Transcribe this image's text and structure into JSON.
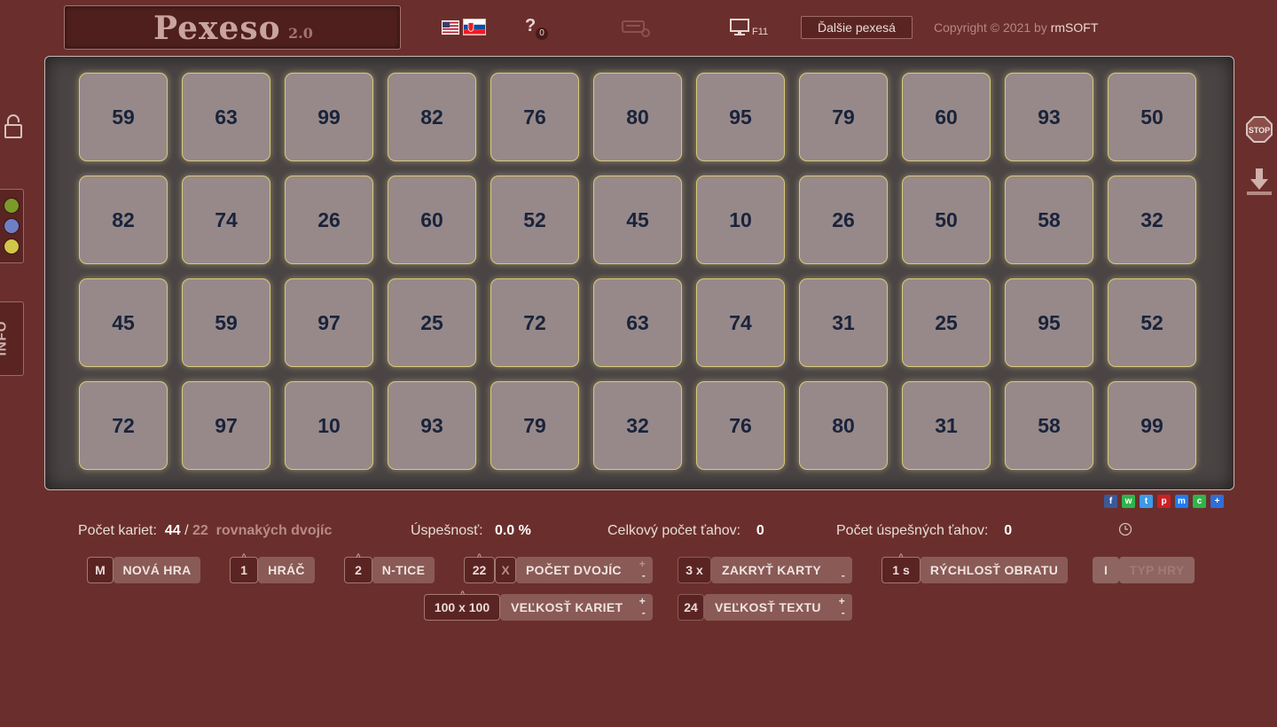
{
  "header": {
    "title": "Pexeso",
    "version": "2.0",
    "help_count": "0",
    "fullscreen_key": "F11",
    "more_games_label": "Ďalšie pexesá",
    "copyright_text": "Copyright © 2021 by ",
    "copyright_brand": "rmSOFT"
  },
  "colors": {
    "background": "#6a2f2c",
    "card": "#978989",
    "card_border": "#d8c97a",
    "number": "#19233b",
    "board": "#4a4444"
  },
  "side": {
    "info_label": "INFO",
    "dots": [
      "#7c9a2a",
      "#6f7fc4",
      "#cfc64a"
    ]
  },
  "board": {
    "rows": [
      [
        "59",
        "63",
        "99",
        "82",
        "76",
        "80",
        "95",
        "79",
        "60",
        "93",
        "50"
      ],
      [
        "82",
        "74",
        "26",
        "60",
        "52",
        "45",
        "10",
        "26",
        "50",
        "58",
        "32"
      ],
      [
        "45",
        "59",
        "97",
        "25",
        "72",
        "63",
        "74",
        "31",
        "25",
        "95",
        "52"
      ],
      [
        "72",
        "97",
        "10",
        "93",
        "79",
        "32",
        "76",
        "80",
        "31",
        "58",
        "99"
      ]
    ]
  },
  "share_icons": [
    {
      "name": "facebook-icon",
      "glyph": "f",
      "color": "#3b5998"
    },
    {
      "name": "whatsapp-icon",
      "glyph": "w",
      "color": "#2fb44b"
    },
    {
      "name": "twitter-icon",
      "glyph": "t",
      "color": "#3d9ae8"
    },
    {
      "name": "pinterest-icon",
      "glyph": "p",
      "color": "#cb2027"
    },
    {
      "name": "messenger-icon",
      "glyph": "m",
      "color": "#1f7bf2"
    },
    {
      "name": "wechat-icon",
      "glyph": "c",
      "color": "#2fb44b"
    },
    {
      "name": "addthis-icon",
      "glyph": "+",
      "color": "#2f6ed8"
    }
  ],
  "stats": {
    "cards_label": "Počet kariet:",
    "cards_value": "44",
    "slash": "/",
    "pairs_value": "22",
    "pairs_label": "rovnakých dvojíc",
    "success_label": "Úspešnosť:",
    "success_value": "0.0 %",
    "total_moves_label": "Celkový počet ťahov:",
    "total_moves_value": "0",
    "successful_moves_label": "Počet úspešných ťahov:",
    "successful_moves_value": "0"
  },
  "controls": {
    "new_game": {
      "key": "M",
      "label": "NOVÁ HRA"
    },
    "player": {
      "key": "1",
      "label": "HRÁČ"
    },
    "ntice": {
      "key": "2",
      "label": "N-TICE"
    },
    "pairs": {
      "key": "22",
      "x": "X",
      "label": "POČET DVOJÍC"
    },
    "cover": {
      "key": "3 x",
      "label": "ZAKRYŤ KARTY"
    },
    "speed": {
      "key": "1 s",
      "label": "RÝCHLOSŤ OBRATU"
    },
    "game_type": {
      "key": "I",
      "label": "TYP HRY"
    },
    "card_size": {
      "key": "100 x 100",
      "label": "VEĽKOSŤ KARIET"
    },
    "text_size": {
      "key": "24",
      "label": "VEĽKOSŤ TEXTU"
    },
    "plus": "+",
    "minus": "-"
  }
}
